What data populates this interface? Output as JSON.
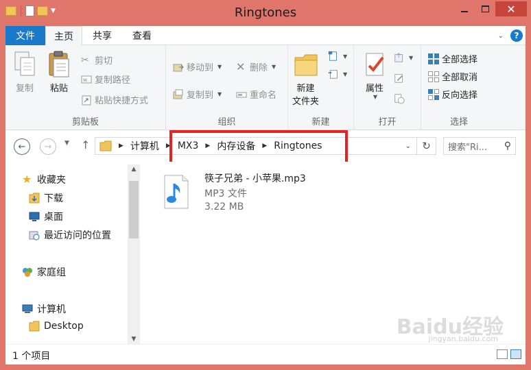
{
  "window": {
    "title": "Ringtones",
    "minimize": "—",
    "maximize": "▢",
    "close": "✕"
  },
  "tabs": {
    "file": "文件",
    "home": "主页",
    "share": "共享",
    "view": "查看",
    "help": "?"
  },
  "ribbon": {
    "clipboard": {
      "label": "剪贴板",
      "copy": "复制",
      "paste": "粘贴",
      "cut": "剪切",
      "copy_path": "复制路径",
      "paste_shortcut": "粘贴快捷方式"
    },
    "organize": {
      "label": "组织",
      "move_to": "移动到",
      "copy_to": "复制到",
      "delete": "删除",
      "rename": "重命名"
    },
    "new": {
      "label": "新建",
      "new_folder": "新建\n文件夹",
      "new_folder_line1": "新建",
      "new_folder_line2": "文件夹"
    },
    "open": {
      "label": "打开",
      "properties": "属性"
    },
    "select": {
      "label": "选择",
      "select_all": "全部选择",
      "select_none": "全部取消",
      "invert": "反向选择"
    }
  },
  "address": {
    "crumbs": [
      "计算机",
      "MX3",
      "内存设备",
      "Ringtones"
    ],
    "search_placeholder": "搜索\"Ri...",
    "refresh": "↻"
  },
  "navpane": {
    "items": [
      {
        "label": "收藏夹",
        "icon": "star-icon"
      },
      {
        "label": "下载",
        "icon": "downloads-folder-icon"
      },
      {
        "label": "桌面",
        "icon": "desktop-icon"
      },
      {
        "label": "最近访问的位置",
        "icon": "recent-places-icon"
      },
      {
        "label": "家庭组",
        "icon": "homegroup-icon"
      },
      {
        "label": "计算机",
        "icon": "computer-icon"
      },
      {
        "label": "Desktop",
        "icon": "folder-icon"
      }
    ]
  },
  "files": [
    {
      "name": "筷子兄弟 - 小苹果.mp3",
      "type": "MP3 文件",
      "size": "3.22 MB",
      "icon": "music-file-icon"
    }
  ],
  "status": {
    "count": "1 个项目"
  },
  "watermark": {
    "brand": "Baidu经验",
    "url": "jingyan.baidu.com"
  },
  "colors": {
    "frame": "#e0756b",
    "file_tab": "#1979ca",
    "highlight_box": "#e52222"
  }
}
